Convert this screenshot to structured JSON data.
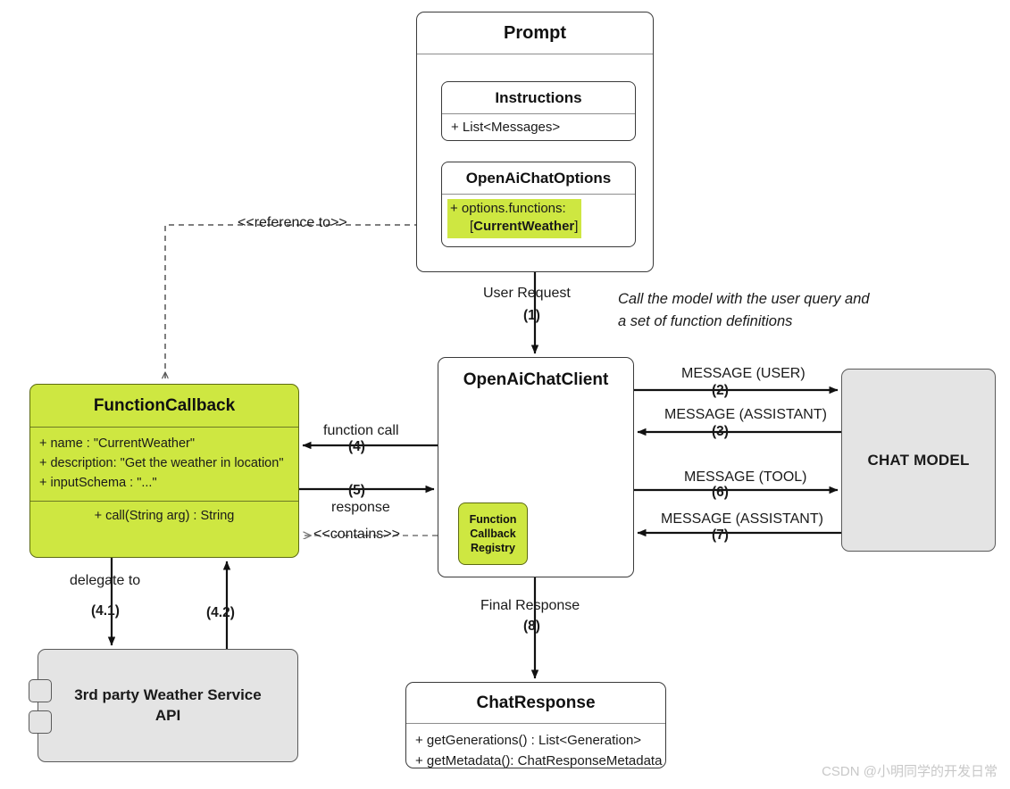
{
  "diagram": {
    "title": "Spring AI Function Calling flow",
    "colors": {
      "accent_green": "#cee741",
      "box_grey": "#e4e4e4",
      "line": "#111111",
      "watermark": "#c8c8c8"
    }
  },
  "prompt": {
    "title": "Prompt",
    "instructions": {
      "title": "Instructions",
      "attribute": "+ List<Messages>"
    },
    "options": {
      "title": "OpenAiChatOptions",
      "attribute_line1": "+ options.functions:",
      "attribute_line2_prefix": "[",
      "attribute_line2_bold": "CurrentWeather",
      "attribute_line2_suffix": "]"
    }
  },
  "function_callback": {
    "title": "FunctionCallback",
    "attributes": [
      "+ name : \"CurrentWeather\"",
      "+ description: \"Get the weather in location\"",
      "+ inputSchema : \"...\""
    ],
    "operations": [
      "+ call(String arg) : String"
    ]
  },
  "chat_client": {
    "title": "OpenAiChatClient",
    "registry_label_line1": "Function",
    "registry_label_line2": "Callback",
    "registry_label_line3": "Registry"
  },
  "chat_model": {
    "label": "CHAT MODEL"
  },
  "weather_service": {
    "label_line1": "3rd party Weather Service",
    "label_line2": "API"
  },
  "chat_response": {
    "title": "ChatResponse",
    "operations": [
      "+ getGenerations() : List<Generation>",
      "+ getMetadata(): ChatResponseMetadata"
    ]
  },
  "edges": {
    "reference_to": "<<reference to>>",
    "contains": "<<contains>>",
    "user_request": {
      "label": "User Request",
      "step": "(1)"
    },
    "note_call_model": "Call the model with the user query and a set of function definitions",
    "message_user": {
      "label": "MESSAGE (USER)",
      "step": "(2)"
    },
    "message_assistant_1": {
      "label": "MESSAGE (ASSISTANT)",
      "step": "(3)"
    },
    "function_call": {
      "label": "function call",
      "step": "(4)"
    },
    "response": {
      "label": "response",
      "step": "(5)"
    },
    "message_tool": {
      "label": "MESSAGE (TOOL)",
      "step": "(6)"
    },
    "message_assistant_2": {
      "label": "MESSAGE (ASSISTANT)",
      "step": "(7)"
    },
    "final_response": {
      "label": "Final Response",
      "step": "(8)"
    },
    "delegate_to": {
      "label": "delegate to",
      "step": "(4.1)"
    },
    "delegate_return": {
      "step": "(4.2)"
    }
  },
  "watermark": {
    "text": "CSDN @小明同学的开发日常"
  }
}
